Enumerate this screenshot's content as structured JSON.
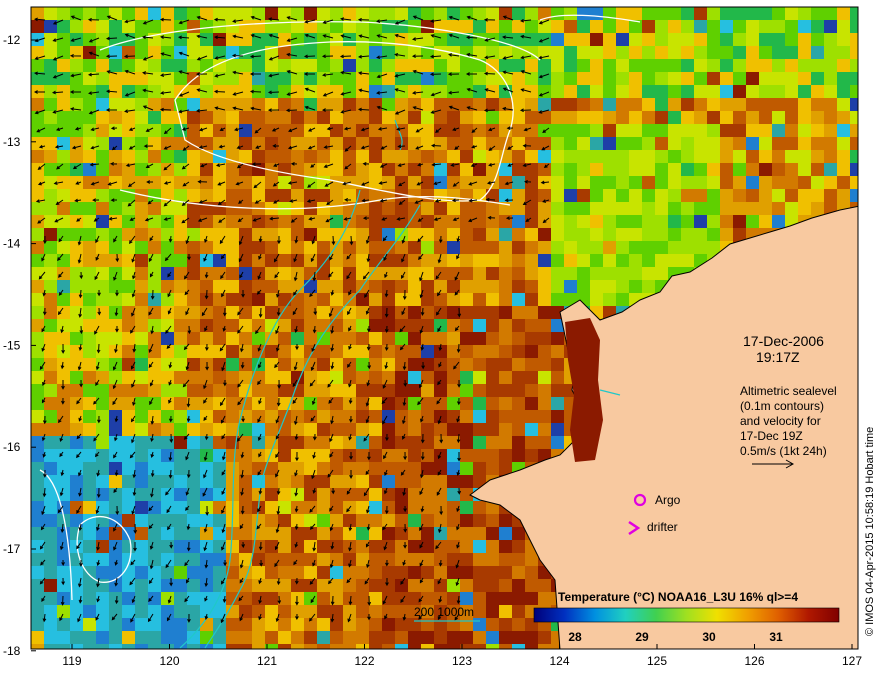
{
  "map": {
    "lon_ticks": [
      "119",
      "120",
      "121",
      "122",
      "123",
      "124",
      "125",
      "126",
      "127"
    ],
    "lat_ticks": [
      "-12",
      "-13",
      "-14",
      "-15",
      "-16",
      "-17",
      "-18"
    ],
    "ocean_palette": [
      "#8b1a00",
      "#a83a00",
      "#c05a00",
      "#d27a00",
      "#e0a000",
      "#f0c000",
      "#c8e400",
      "#9ee000",
      "#5fd000",
      "#22b84a",
      "#2aa6a6",
      "#26bfe0",
      "#1f7fd0",
      "#1e3fa8"
    ],
    "land_color": "#f8c9a0",
    "contour_color": "#ffffff",
    "isobath_color": "#20c8c8"
  },
  "info": {
    "date": "17-Dec-2006",
    "time": "19:17Z",
    "alt_lines": [
      "Altimetric sealevel",
      "(0.1m contours)",
      "and velocity for",
      "17-Dec 19Z",
      "0.5m/s (1kt 24h)"
    ]
  },
  "legend": {
    "argo_label": "Argo",
    "drifter_label": "drifter",
    "argo_color": "#e000e0",
    "drifter_color": "#e000e0"
  },
  "isobath_label": "200  1000m",
  "colorbar": {
    "title": "Temperature (°C) NOAA16_L3U 16% ql>=4",
    "ticks": [
      "28",
      "29",
      "30",
      "31"
    ],
    "stops": [
      "#00007a",
      "#0030c0",
      "#0090e0",
      "#20d0c0",
      "#40d050",
      "#a0e020",
      "#f0e000",
      "#f0a000",
      "#e06000",
      "#b01800",
      "#800000"
    ]
  },
  "credit": "© IMOS 04-Apr-2015 10:58:19 Hobart time"
}
